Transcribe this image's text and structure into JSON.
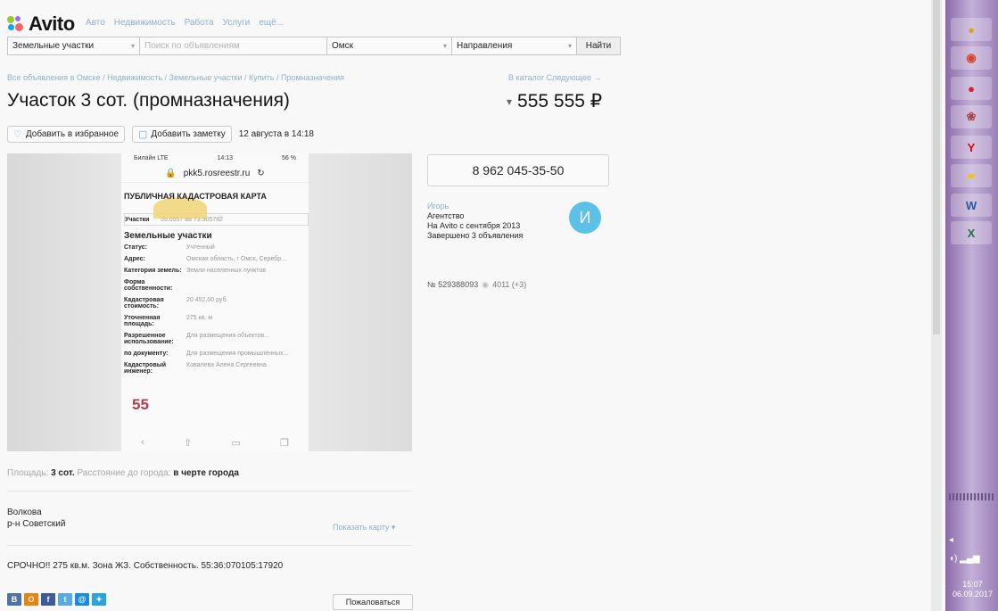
{
  "header": {
    "logo_text": "Avito",
    "nav": [
      "Авто",
      "Недвижимость",
      "Работа",
      "Услуги",
      "ещё..."
    ]
  },
  "search": {
    "category": "Земельные участки",
    "query_placeholder": "Поиск по объявлениям",
    "city": "Омск",
    "direction": "Направления",
    "find_label": "Найти"
  },
  "breadcrumbs": "Все объявления в Омске / Недвижимость / Земельные участки / Купить / Промназначения",
  "breadcrumbs_right": "В каталог   Следующее →",
  "listing": {
    "title": "Участок 3 сот. (промназначения)",
    "price": "555 555 ₽",
    "add_favorite": "Добавить в избранное",
    "add_note": "Добавить заметку",
    "date": "12 августа в 14:18"
  },
  "photo": {
    "status_left": "Билайн LTE",
    "status_time": "14:13",
    "status_right": "56 %",
    "url": "pkk5.rosreestr.ru",
    "map_title": "ПУБЛИЧНАЯ КАДАСТРОВАЯ КАРТА",
    "search_label": "Участки",
    "search_value": "55.0557 88 73.905782",
    "section_title": "Земельные участки",
    "rows": [
      {
        "k": "Статус:",
        "v": "Учтенный"
      },
      {
        "k": "Адрес:",
        "v": "Омская область, г Омск, Серебр..."
      },
      {
        "k": "Категория земель:",
        "v": "Земли населенных пунктов"
      },
      {
        "k": "Форма собственности:",
        "v": ""
      },
      {
        "k": "Кадастровая стоимость:",
        "v": "20 452,00 руб."
      },
      {
        "k": "Уточненная площадь:",
        "v": "275 кв. м"
      },
      {
        "k": "Разрешенное использование:",
        "v": "Для размещения объектов..."
      },
      {
        "k": "по документу:",
        "v": "Для размещения промышленных..."
      },
      {
        "k": "Кадастровый инженер:",
        "v": "Ковалева Алена Сергеевна"
      }
    ],
    "big_number": "55"
  },
  "seller": {
    "phone": "8 962 045-35-50",
    "name": "Игорь",
    "type": "Агентство",
    "since": "На Avito с сентября 2013",
    "completed": "Завершено 3 объявления",
    "avatar_letter": "И",
    "ad_id": "№ 529388093",
    "views": "4011 (+3)"
  },
  "params": {
    "area_label": "Площадь:",
    "area_value": "3 сот.",
    "distance_label": "Расстояние до города:",
    "distance_value": "в черте города"
  },
  "address": {
    "line1": "Волкова",
    "line2": "р-н Советский",
    "show_map": "Показать карту ▾"
  },
  "description": "СРОЧНО!! 275 кв.м. Зона ЖЗ. Собственность. 55:36:070105:17920",
  "social": [
    {
      "label": "В",
      "color": "#4c75a3"
    },
    {
      "label": "О",
      "color": "#ee8208"
    },
    {
      "label": "f",
      "color": "#3b5998"
    },
    {
      "label": "t",
      "color": "#55acee"
    },
    {
      "label": "@",
      "color": "#168de2"
    },
    {
      "label": "✦",
      "color": "#26a5e4"
    }
  ],
  "complain": "Пожаловаться",
  "taskbar": {
    "time": "15:07",
    "date": "06.09.2017"
  }
}
